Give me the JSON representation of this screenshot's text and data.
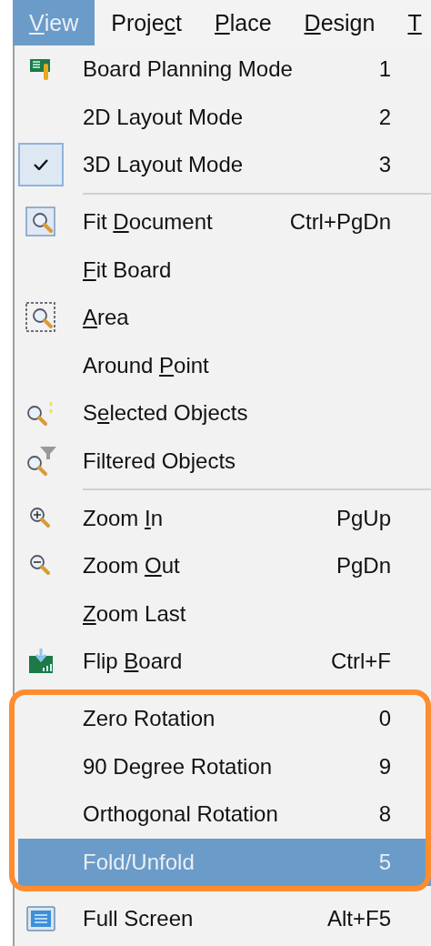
{
  "menubar": [
    {
      "access_key": "V",
      "text_after": "iew",
      "selected": true
    },
    {
      "text_before": "Proje",
      "access_key": "c",
      "text_after": "t",
      "selected": false
    },
    {
      "access_key": "P",
      "text_after": "lace",
      "selected": false
    },
    {
      "access_key": "D",
      "text_after": "esign",
      "selected": false
    },
    {
      "access_key": "T",
      "selected": false
    }
  ],
  "menu": [
    {
      "kind": "item",
      "label": "Board Planning Mode",
      "shortcut": "1",
      "checked": false,
      "selected": false,
      "annotated": false
    },
    {
      "kind": "item",
      "label": "2D Layout Mode",
      "shortcut": "2",
      "checked": false,
      "selected": false,
      "annotated": false
    },
    {
      "kind": "item",
      "label": "3D Layout Mode",
      "shortcut": "3",
      "checked": true,
      "selected": false,
      "annotated": false
    },
    {
      "kind": "separator"
    },
    {
      "kind": "item",
      "text_before": "Fit ",
      "access_key": "D",
      "text_after": "ocument",
      "shortcut": "Ctrl+PgDn",
      "checked": false,
      "selected": false,
      "annotated": false
    },
    {
      "kind": "item",
      "access_key": "F",
      "text_after": "it Board",
      "checked": false,
      "selected": false,
      "annotated": false
    },
    {
      "kind": "item",
      "access_key": "A",
      "text_after": "rea",
      "checked": false,
      "selected": false,
      "annotated": false
    },
    {
      "kind": "item",
      "text_before": "Around ",
      "access_key": "P",
      "text_after": "oint",
      "checked": false,
      "selected": false,
      "annotated": false
    },
    {
      "kind": "item",
      "text_before": "S",
      "access_key": "e",
      "text_after": "lected Objects",
      "checked": false,
      "selected": false,
      "annotated": false
    },
    {
      "kind": "item",
      "label": "Filtered Objects",
      "checked": false,
      "selected": false,
      "annotated": false
    },
    {
      "kind": "separator"
    },
    {
      "kind": "item",
      "text_before": "Zoom ",
      "access_key": "I",
      "text_after": "n",
      "shortcut": "PgUp",
      "checked": false,
      "selected": false,
      "annotated": false
    },
    {
      "kind": "item",
      "text_before": "Zoom ",
      "access_key": "O",
      "text_after": "ut",
      "shortcut": "PgDn",
      "checked": false,
      "selected": false,
      "annotated": false
    },
    {
      "kind": "item",
      "access_key": "Z",
      "text_after": "oom Last",
      "checked": false,
      "selected": false,
      "annotated": false
    },
    {
      "kind": "item",
      "text_before": "Flip ",
      "access_key": "B",
      "text_after": "oard",
      "shortcut": "Ctrl+F",
      "checked": false,
      "selected": false,
      "annotated": false
    },
    {
      "kind": "item",
      "label": "Zero Rotation",
      "shortcut": "0",
      "checked": false,
      "selected": false,
      "annotated": true
    },
    {
      "kind": "item",
      "label": "90 Degree Rotation",
      "shortcut": "9",
      "checked": false,
      "selected": false,
      "annotated": true
    },
    {
      "kind": "item",
      "label": "Orthogonal Rotation",
      "shortcut": "8",
      "checked": false,
      "selected": false,
      "annotated": true
    },
    {
      "kind": "item",
      "label": "Fold/Unfold",
      "shortcut": "5",
      "checked": false,
      "selected": true,
      "annotated": true
    },
    {
      "kind": "item",
      "label": "Full Screen",
      "shortcut": "Alt+F5",
      "checked": false,
      "selected": false,
      "annotated": false
    }
  ]
}
